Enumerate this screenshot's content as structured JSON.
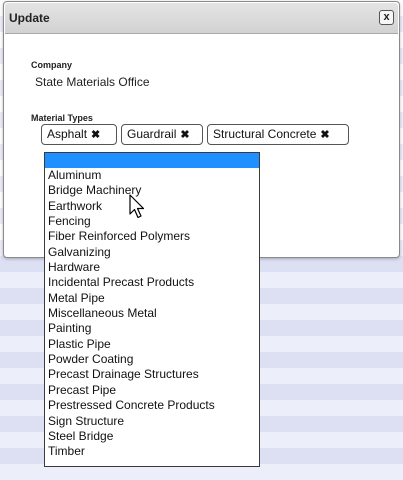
{
  "dialog": {
    "title": "Update",
    "close_label": "x"
  },
  "company": {
    "label": "Company",
    "value": "State Materials Office"
  },
  "material_types": {
    "label": "Material Types",
    "selected_tags": [
      {
        "label": "Asphalt"
      },
      {
        "label": "Guardrail"
      },
      {
        "label": "Structural Concrete"
      }
    ],
    "remove_glyph": "✖"
  },
  "dropdown": {
    "options": [
      {
        "label": ""
      },
      {
        "label": "Aluminum"
      },
      {
        "label": "Bridge Machinery"
      },
      {
        "label": "Earthwork"
      },
      {
        "label": "Fencing"
      },
      {
        "label": "Fiber Reinforced Polymers"
      },
      {
        "label": "Galvanizing"
      },
      {
        "label": "Hardware"
      },
      {
        "label": "Incidental Precast Products"
      },
      {
        "label": "Metal Pipe"
      },
      {
        "label": "Miscellaneous Metal"
      },
      {
        "label": "Painting"
      },
      {
        "label": "Plastic Pipe"
      },
      {
        "label": "Powder Coating"
      },
      {
        "label": "Precast Drainage Structures"
      },
      {
        "label": "Precast Pipe"
      },
      {
        "label": "Prestressed Concrete Products"
      },
      {
        "label": "Sign Structure"
      },
      {
        "label": "Steel Bridge"
      },
      {
        "label": "Timber"
      }
    ]
  },
  "colors": {
    "highlight": "#1e90ff",
    "stripe_a": "#dde0f3",
    "stripe_b": "#eceefa"
  }
}
